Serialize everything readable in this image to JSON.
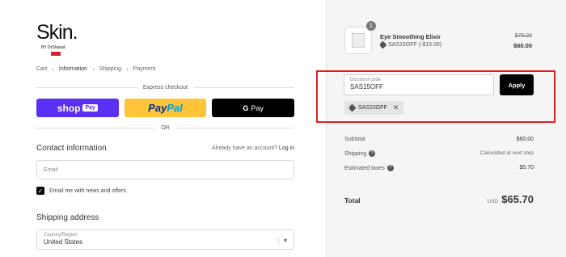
{
  "brand": {
    "name": "Skin.",
    "byline": "BY DrSharad"
  },
  "breadcrumb": [
    "Cart",
    "Information",
    "Shipping",
    "Payment"
  ],
  "express": {
    "title": "Express checkout",
    "shoppay": "shop",
    "shoppay_tag": "Pay",
    "paypal_a": "Pay",
    "paypal_b": "Pal",
    "gpay_g": "G",
    "gpay": "Pay",
    "or": "OR"
  },
  "contact": {
    "title": "Contact information",
    "have_account": "Already have an account?",
    "login": "Log in",
    "email_placeholder": "Email",
    "newsletter_label": "Email me with news and offers"
  },
  "shipping": {
    "title": "Shipping address",
    "country_label": "Country/Region",
    "country_value": "United States"
  },
  "order": {
    "qty": "1",
    "product_name": "Eye Smoothing Elixir",
    "product_discount": "SAS15OFF (-$15.00)",
    "price_old": "$75.00",
    "price_new": "$60.00"
  },
  "discount": {
    "label": "Discount code",
    "value": "SAS15OFF",
    "apply": "Apply",
    "chip": "SAS15OFF"
  },
  "summary": {
    "subtotal_label": "Subtotal",
    "subtotal": "$60.00",
    "shipping_label": "Shipping",
    "shipping": "Calculated at next step",
    "taxes_label": "Estimated taxes",
    "taxes": "$5.70",
    "total_label": "Total",
    "currency": "USD",
    "total": "$65.70"
  },
  "colors": {
    "shoppay": "#5a31f4",
    "paypal": "#ffc439",
    "highlight": "#e02020"
  }
}
